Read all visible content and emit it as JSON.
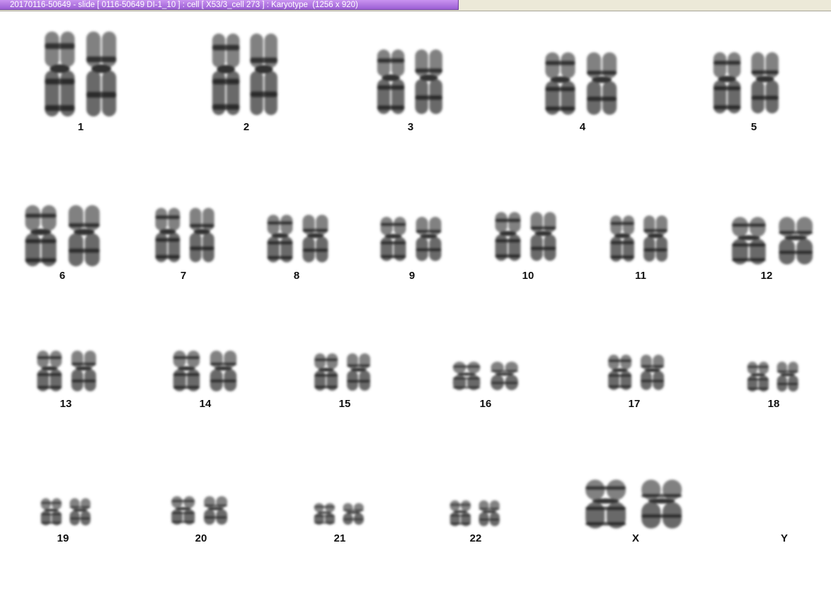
{
  "window": {
    "title": "20170116-50649 - slide [ 0116-50649 DI-1_10 ] : cell [ X53/3_cell 273 ] : Karyotype  (1256 x 920)"
  },
  "colors": {
    "tab_accent": "#b57ae6",
    "chromosome_dark": "#1a1a1a",
    "background": "#ffffff"
  },
  "karyotype": {
    "c1": "1",
    "c2": "2",
    "c3": "3",
    "c4": "4",
    "c5": "5",
    "c6": "6",
    "c7": "7",
    "c8": "8",
    "c9": "9",
    "c10": "10",
    "c11": "11",
    "c12": "12",
    "c13": "13",
    "c14": "14",
    "c15": "15",
    "c16": "16",
    "c17": "17",
    "c18": "18",
    "c19": "19",
    "c20": "20",
    "c21": "21",
    "c22": "22",
    "cX": "X",
    "cY": "Y"
  }
}
